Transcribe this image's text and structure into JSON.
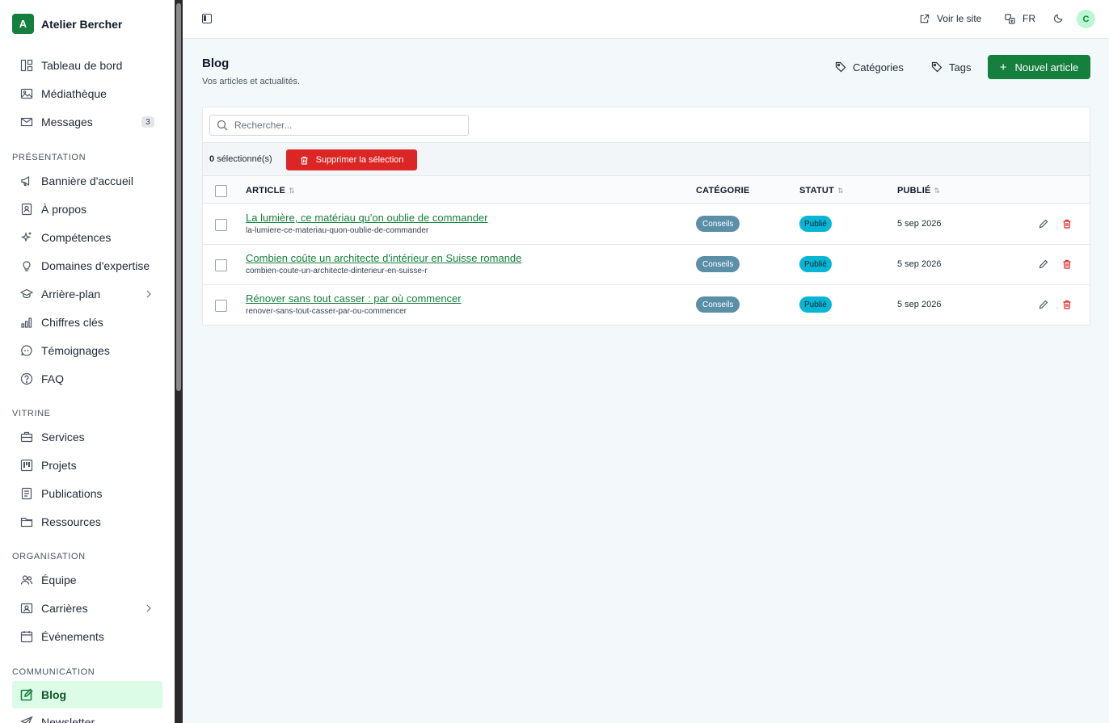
{
  "brand": {
    "initial": "A",
    "name": "Atelier Bercher"
  },
  "sidebar": {
    "top_items": [
      {
        "label": "Tableau de bord",
        "icon": "dashboard-icon"
      },
      {
        "label": "Médiathèque",
        "icon": "image-icon"
      },
      {
        "label": "Messages",
        "icon": "mail-icon",
        "badge": "3"
      }
    ],
    "sections": [
      {
        "title": "PRÉSENTATION",
        "items": [
          {
            "label": "Bannière d'accueil",
            "icon": "megaphone-icon"
          },
          {
            "label": "À propos",
            "icon": "contact-icon"
          },
          {
            "label": "Compétences",
            "icon": "sparkles-icon"
          },
          {
            "label": "Domaines d'expertise",
            "icon": "lightbulb-icon"
          },
          {
            "label": "Arrière-plan",
            "icon": "graduation-icon",
            "chevron": true
          },
          {
            "label": "Chiffres clés",
            "icon": "bar-chart-icon"
          },
          {
            "label": "Témoignages",
            "icon": "quote-icon"
          },
          {
            "label": "FAQ",
            "icon": "help-icon"
          }
        ]
      },
      {
        "title": "VITRINE",
        "items": [
          {
            "label": "Services",
            "icon": "briefcase-icon"
          },
          {
            "label": "Projets",
            "icon": "kanban-icon"
          },
          {
            "label": "Publications",
            "icon": "document-icon"
          },
          {
            "label": "Ressources",
            "icon": "folder-icon"
          }
        ]
      },
      {
        "title": "ORGANISATION",
        "items": [
          {
            "label": "Équipe",
            "icon": "users-icon"
          },
          {
            "label": "Carrières",
            "icon": "badge-icon",
            "chevron": true
          },
          {
            "label": "Événements",
            "icon": "calendar-icon"
          }
        ]
      },
      {
        "title": "COMMUNICATION",
        "items": [
          {
            "label": "Blog",
            "icon": "edit-icon",
            "active": true
          },
          {
            "label": "Newsletter",
            "icon": "send-icon"
          }
        ]
      }
    ]
  },
  "topbar": {
    "view_site": "Voir le site",
    "language": "FR",
    "avatar_initial": "C"
  },
  "page": {
    "title": "Blog",
    "subtitle": "Vos articles et actualités.",
    "categories_btn": "Catégories",
    "tags_btn": "Tags",
    "new_btn": "Nouvel article"
  },
  "table": {
    "search_placeholder": "Rechercher...",
    "selected_count": "0",
    "selected_suffix": "sélectionné(s)",
    "delete_selection": "Supprimer la sélection",
    "headers": {
      "article": "ARTICLE",
      "category": "CATÉGORIE",
      "status": "STATUT",
      "published": "PUBLIÉ"
    },
    "rows": [
      {
        "title": "La lumière, ce matériau qu'on oublie de commander",
        "slug": "la-lumiere-ce-materiau-quon-oublie-de-commander",
        "category": "Conseils",
        "status": "Publié",
        "date": "5 sep 2026"
      },
      {
        "title": "Combien coûte un architecte d'intérieur en Suisse romande",
        "slug": "combien-coute-un-architecte-dinterieur-en-suisse-r",
        "category": "Conseils",
        "status": "Publié",
        "date": "5 sep 2026"
      },
      {
        "title": "Rénover sans tout casser : par où commencer",
        "slug": "renover-sans-tout-casser-par-ou-commencer",
        "category": "Conseils",
        "status": "Publié",
        "date": "5 sep 2026"
      }
    ]
  },
  "colors": {
    "accent": "#15803d",
    "danger": "#dc2626",
    "status": "#06b6d4",
    "category": "#5b8fa8"
  }
}
